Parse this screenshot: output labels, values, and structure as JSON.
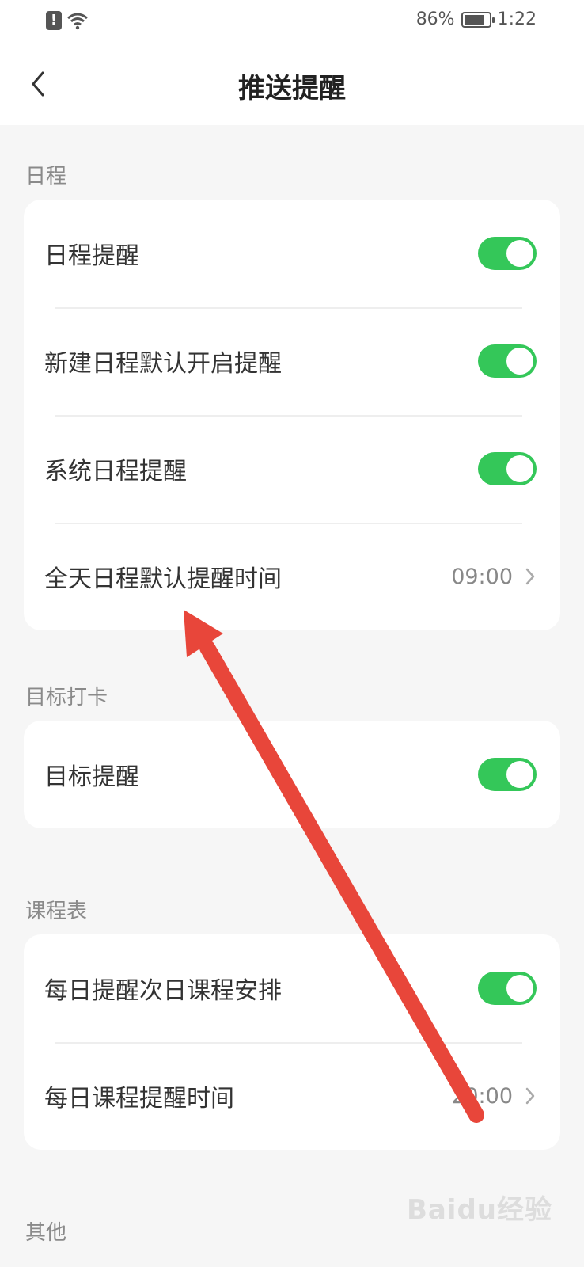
{
  "status_bar": {
    "battery": "86%",
    "time": "1:22"
  },
  "header": {
    "title": "推送提醒",
    "back_icon": "chevron-left-icon"
  },
  "sections": {
    "schedule": {
      "label": "日程",
      "items": [
        {
          "label": "日程提醒",
          "toggle": true
        },
        {
          "label": "新建日程默认开启提醒",
          "toggle": true
        },
        {
          "label": "系统日程提醒",
          "toggle": true
        },
        {
          "label": "全天日程默认提醒时间",
          "value": "09:00"
        }
      ]
    },
    "goal": {
      "label": "目标打卡",
      "items": [
        {
          "label": "目标提醒",
          "toggle": true
        }
      ]
    },
    "timetable": {
      "label": "课程表",
      "items": [
        {
          "label": "每日提醒次日课程安排",
          "toggle": true
        },
        {
          "label": "每日课程提醒时间",
          "value": "20:00"
        }
      ]
    },
    "other": {
      "label": "其他"
    }
  },
  "watermark": "Baidu经验",
  "colors": {
    "toggle_on": "#34c759",
    "annotation_arrow": "#e8463a",
    "background": "#f6f6f6"
  }
}
